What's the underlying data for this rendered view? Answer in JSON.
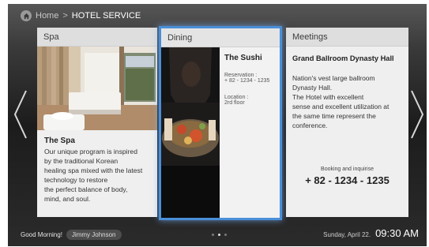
{
  "breadcrumb": {
    "home": "Home",
    "separator": ">",
    "current": "HOTEL SERVICE"
  },
  "icons": {
    "home": "home-icon",
    "prev": "chevron-left-icon",
    "next": "chevron-right-icon"
  },
  "cards": {
    "spa": {
      "header": "Spa",
      "title": "The Spa",
      "description": [
        "Our unique program is inspired",
        "by the traditional Korean",
        "healing spa mixed with the latest",
        "technology to restore",
        "the perfect balance of body,",
        "mind, and soul."
      ]
    },
    "dining": {
      "header": "Dining",
      "title": "The Sushi",
      "reservation_label": "Reservation :",
      "reservation_value": "+ 82 - 1234 - 1235",
      "location_label": "Location :",
      "location_value": "2rd floor"
    },
    "meetings": {
      "header": "Meetings",
      "title": "Grand Ballroom Dynasty Hall",
      "description": [
        "Nation's vest large ballroom",
        "Dynasty Hall.",
        "The Hotel with excellent",
        "sense and excellent utilization at",
        "the same time represent the",
        "conference."
      ],
      "booking_label": "Booking and inquirise",
      "booking_phone": "+ 82 - 1234 - 1235"
    }
  },
  "footer": {
    "greeting": "Good Morning!",
    "user": "Jimmy Johnson",
    "page_indicator": {
      "total": 3,
      "active": 2
    },
    "date": "Sunday, April 22.",
    "time": "09:30 AM"
  },
  "colors": {
    "focus_border": "#4a8fd8",
    "card_background": "#efefef",
    "screen_background": "#1c1c1c"
  }
}
